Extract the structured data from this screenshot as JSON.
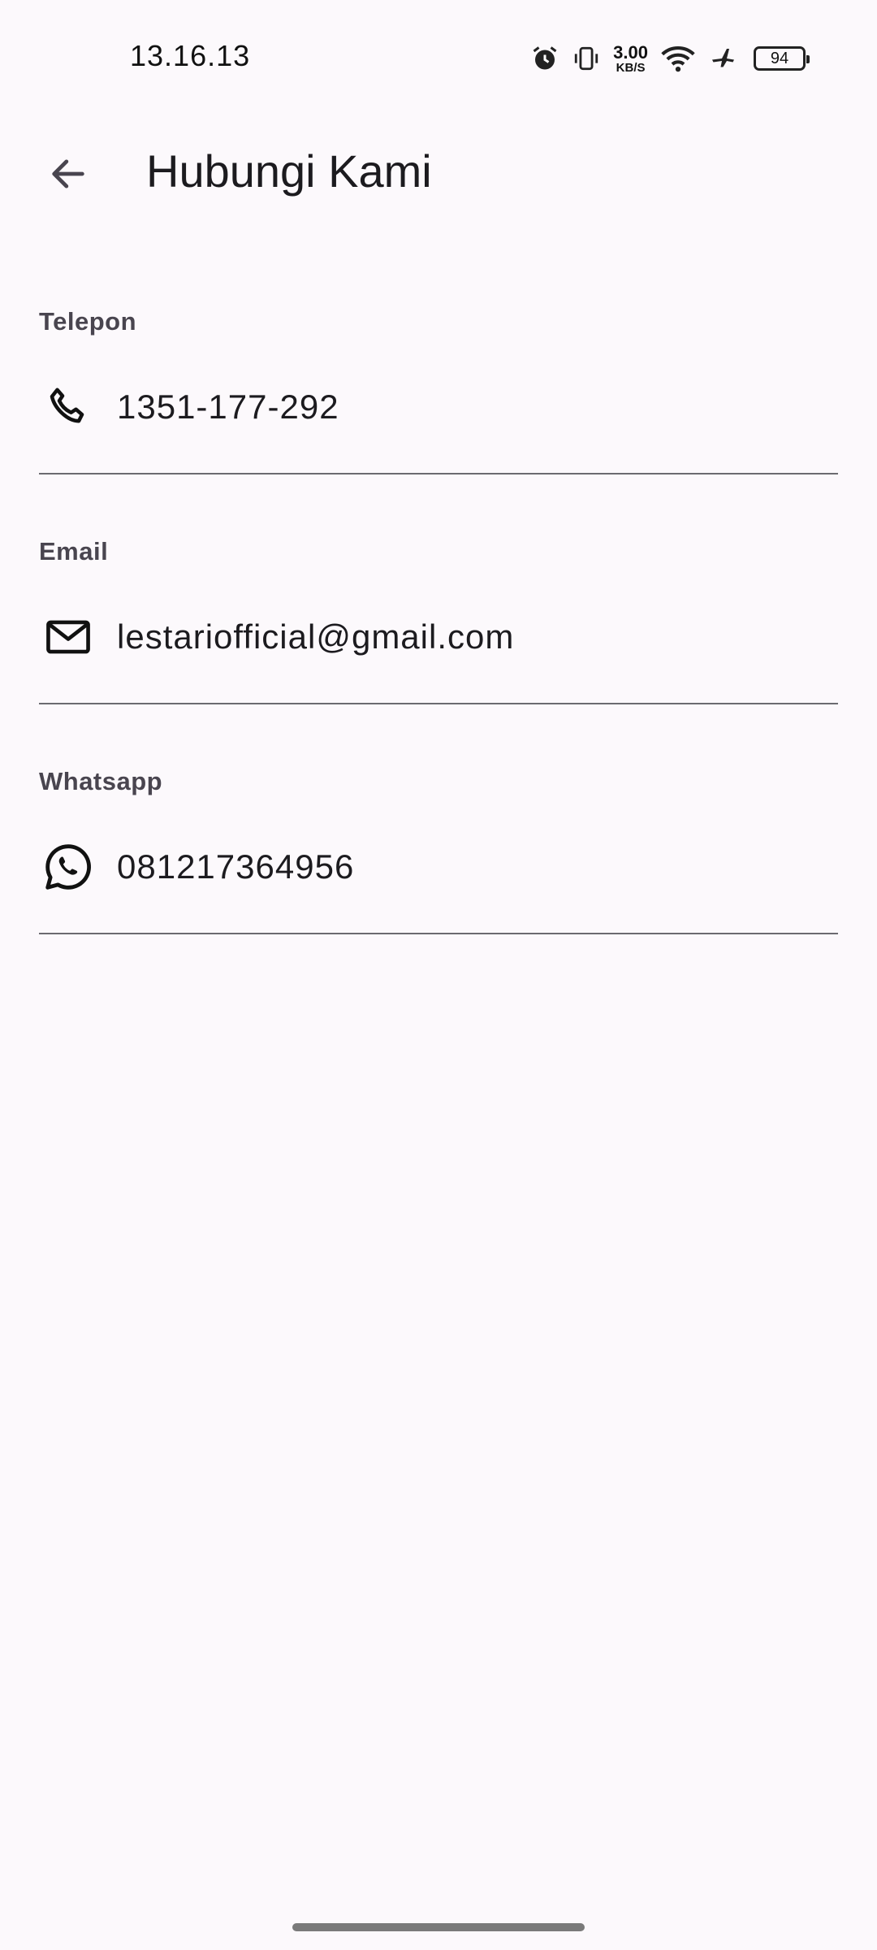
{
  "status_bar": {
    "time": "13.16.13",
    "net_speed_value": "3.00",
    "net_speed_unit": "KB/S",
    "battery": "94",
    "icons": [
      "alarm-icon",
      "vibrate-icon",
      "wifi-icon",
      "airplane-icon",
      "battery-icon"
    ]
  },
  "app_bar": {
    "title": "Hubungi Kami",
    "back_icon": "arrow-back-icon"
  },
  "contacts": [
    {
      "label": "Telepon",
      "value": "1351-177-292",
      "icon": "phone-icon"
    },
    {
      "label": "Email",
      "value": "lestariofficial@gmail.com",
      "icon": "mail-icon"
    },
    {
      "label": "Whatsapp",
      "value": "081217364956",
      "icon": "whatsapp-icon"
    }
  ],
  "colors": {
    "background": "#fcf9fc",
    "text_primary": "#1c1b1f",
    "label": "#49454f",
    "divider": "#6b6b70"
  }
}
